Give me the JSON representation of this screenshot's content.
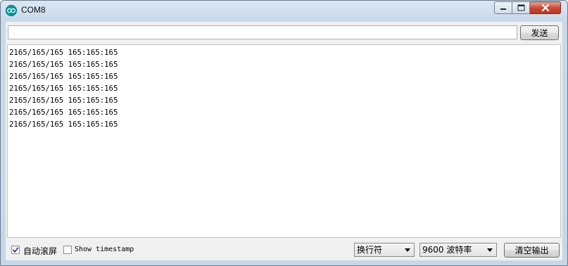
{
  "window": {
    "title": "COM8"
  },
  "input": {
    "value": "",
    "placeholder": ""
  },
  "toolbar": {
    "send_label": "发送"
  },
  "output": {
    "lines": [
      "2165/165/165 165:165:165",
      "2165/165/165 165:165:165",
      "2165/165/165 165:165:165",
      "2165/165/165 165:165:165",
      "2165/165/165 165:165:165",
      "2165/165/165 165:165:165",
      "2165/165/165 165:165:165"
    ]
  },
  "footer": {
    "autoscroll_label": "自动滚屏",
    "autoscroll_checked": true,
    "timestamp_label": "Show timestamp",
    "timestamp_checked": false,
    "line_ending": "换行符",
    "baud_rate": "9600 波特率",
    "clear_label": "清空输出"
  },
  "colors": {
    "accent": "#00979c",
    "close_button": "#c9462f"
  }
}
